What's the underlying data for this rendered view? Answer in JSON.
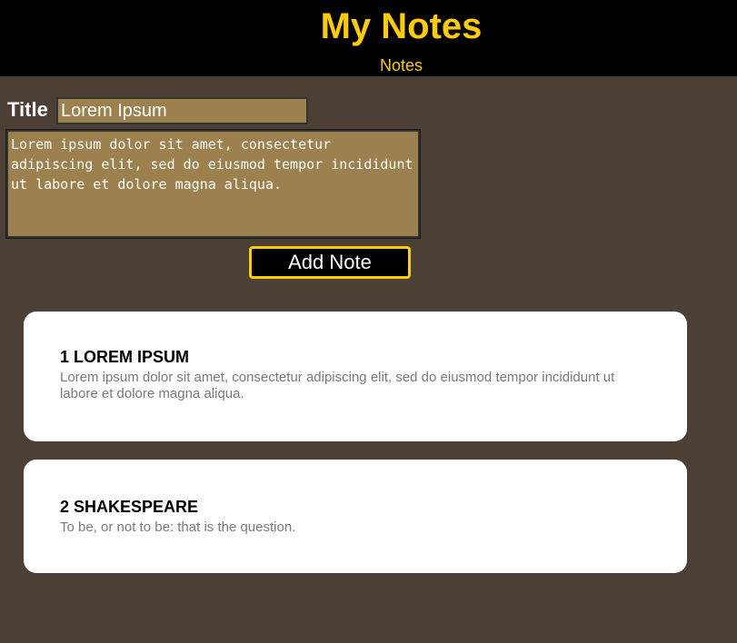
{
  "header": {
    "title": "My Notes",
    "nav_link": "Notes"
  },
  "form": {
    "title_label": "Title",
    "title_value": "Lorem Ipsum",
    "body_value": "Lorem ipsum dolor sit amet, consectetur adipiscing elit, sed do eiusmod tempor incididunt ut labore et dolore magna aliqua.",
    "add_button_label": "Add Note"
  },
  "notes": [
    {
      "number": "1",
      "title": "LOREM IPSUM",
      "text": "Lorem ipsum dolor sit amet, consectetur adipiscing elit, sed do eiusmod tempor incididunt ut labore et dolore magna aliqua."
    },
    {
      "number": "2",
      "title": "SHAKESPEARE",
      "text": "To be, or not to be: that is the question."
    }
  ],
  "colors": {
    "background": "#4b3f36",
    "header_bg": "#000000",
    "accent": "#ffcc00",
    "input_bg": "#9c804e",
    "card_bg": "#ffffff",
    "note_text": "#7a7a7a"
  }
}
